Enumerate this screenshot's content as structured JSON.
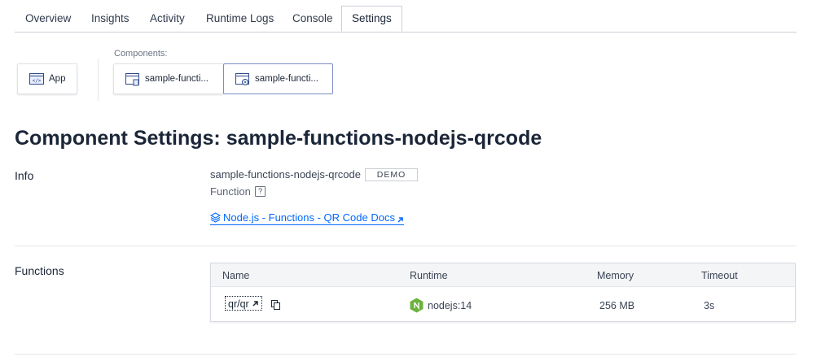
{
  "tabs": [
    {
      "label": "Overview"
    },
    {
      "label": "Insights"
    },
    {
      "label": "Activity"
    },
    {
      "label": "Runtime Logs"
    },
    {
      "label": "Console"
    },
    {
      "label": "Settings",
      "active": true
    }
  ],
  "components": {
    "app_label": "App",
    "label": "Components:",
    "items": [
      {
        "label": "sample-functi..."
      },
      {
        "label": "sample-functi...",
        "selected": true
      }
    ]
  },
  "page_title": "Component Settings: sample-functions-nodejs-qrcode",
  "info": {
    "section_label": "Info",
    "name": "sample-functions-nodejs-qrcode",
    "badge": "DEMO",
    "type": "Function",
    "help_glyph": "?",
    "doc_link": "Node.js - Functions - QR Code Docs"
  },
  "functions": {
    "section_label": "Functions",
    "columns": [
      "Name",
      "Runtime",
      "Memory",
      "Timeout"
    ],
    "rows": [
      {
        "name": "qr/qr",
        "runtime": "nodejs:14",
        "memory": "256 MB",
        "timeout": "3s"
      }
    ]
  },
  "colors": {
    "accent": "#0069ff",
    "node_green": "#6cb33e",
    "text": "#1b2638"
  }
}
